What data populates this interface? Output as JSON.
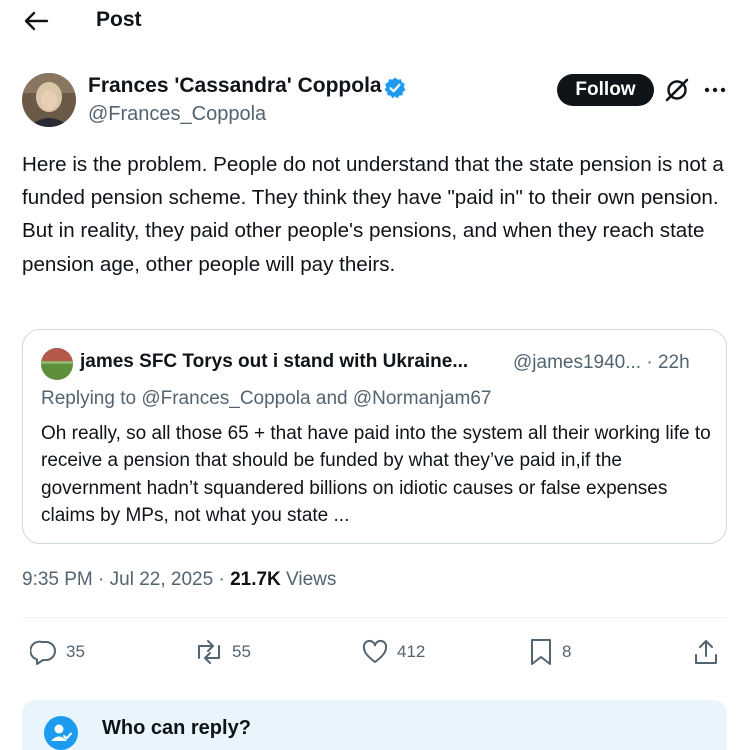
{
  "header": {
    "title": "Post"
  },
  "author": {
    "name": "Frances 'Cassandra' Coppola",
    "handle": "@Frances_Coppola",
    "follow_label": "Follow"
  },
  "post": {
    "text": "Here is the problem. People do not understand that the state pension is not a funded pension scheme. They think they have \"paid in\" to their own pension. But in reality, they paid other people's pensions, and when they reach state pension age, other people will pay theirs."
  },
  "quote": {
    "name": "james SFC Torys out i stand with Ukraine...",
    "meta": "@james1940... · 22h",
    "replying_to": "Replying to @Frances_Coppola and @Normanjam67",
    "text": "Oh really, so all those 65 + that have paid into the system all their working life to receive a pension that should be funded by what they’ve paid in,if the government hadn’t squandered billions on idiotic causes or false expenses claims by MPs, not what you state ..."
  },
  "meta": {
    "time": "9:35 PM · Jul 22, 2025 · ",
    "views_count": "21.7K",
    "views_label": " Views"
  },
  "actions": {
    "replies": "35",
    "reposts": "55",
    "likes": "412",
    "bookmarks": "8"
  },
  "who_can_reply": {
    "title": "Who can reply?"
  },
  "colors": {
    "accent": "#1d9bf0",
    "text": "#0f1419",
    "muted": "#536471",
    "border": "#cfd9de",
    "reply_bg": "#e8f5fd"
  },
  "icons": [
    "back-arrow-icon",
    "verified-badge-icon",
    "grok-icon",
    "more-icon",
    "reply-icon",
    "repost-icon",
    "like-icon",
    "bookmark-icon",
    "share-icon",
    "people-check-icon"
  ]
}
